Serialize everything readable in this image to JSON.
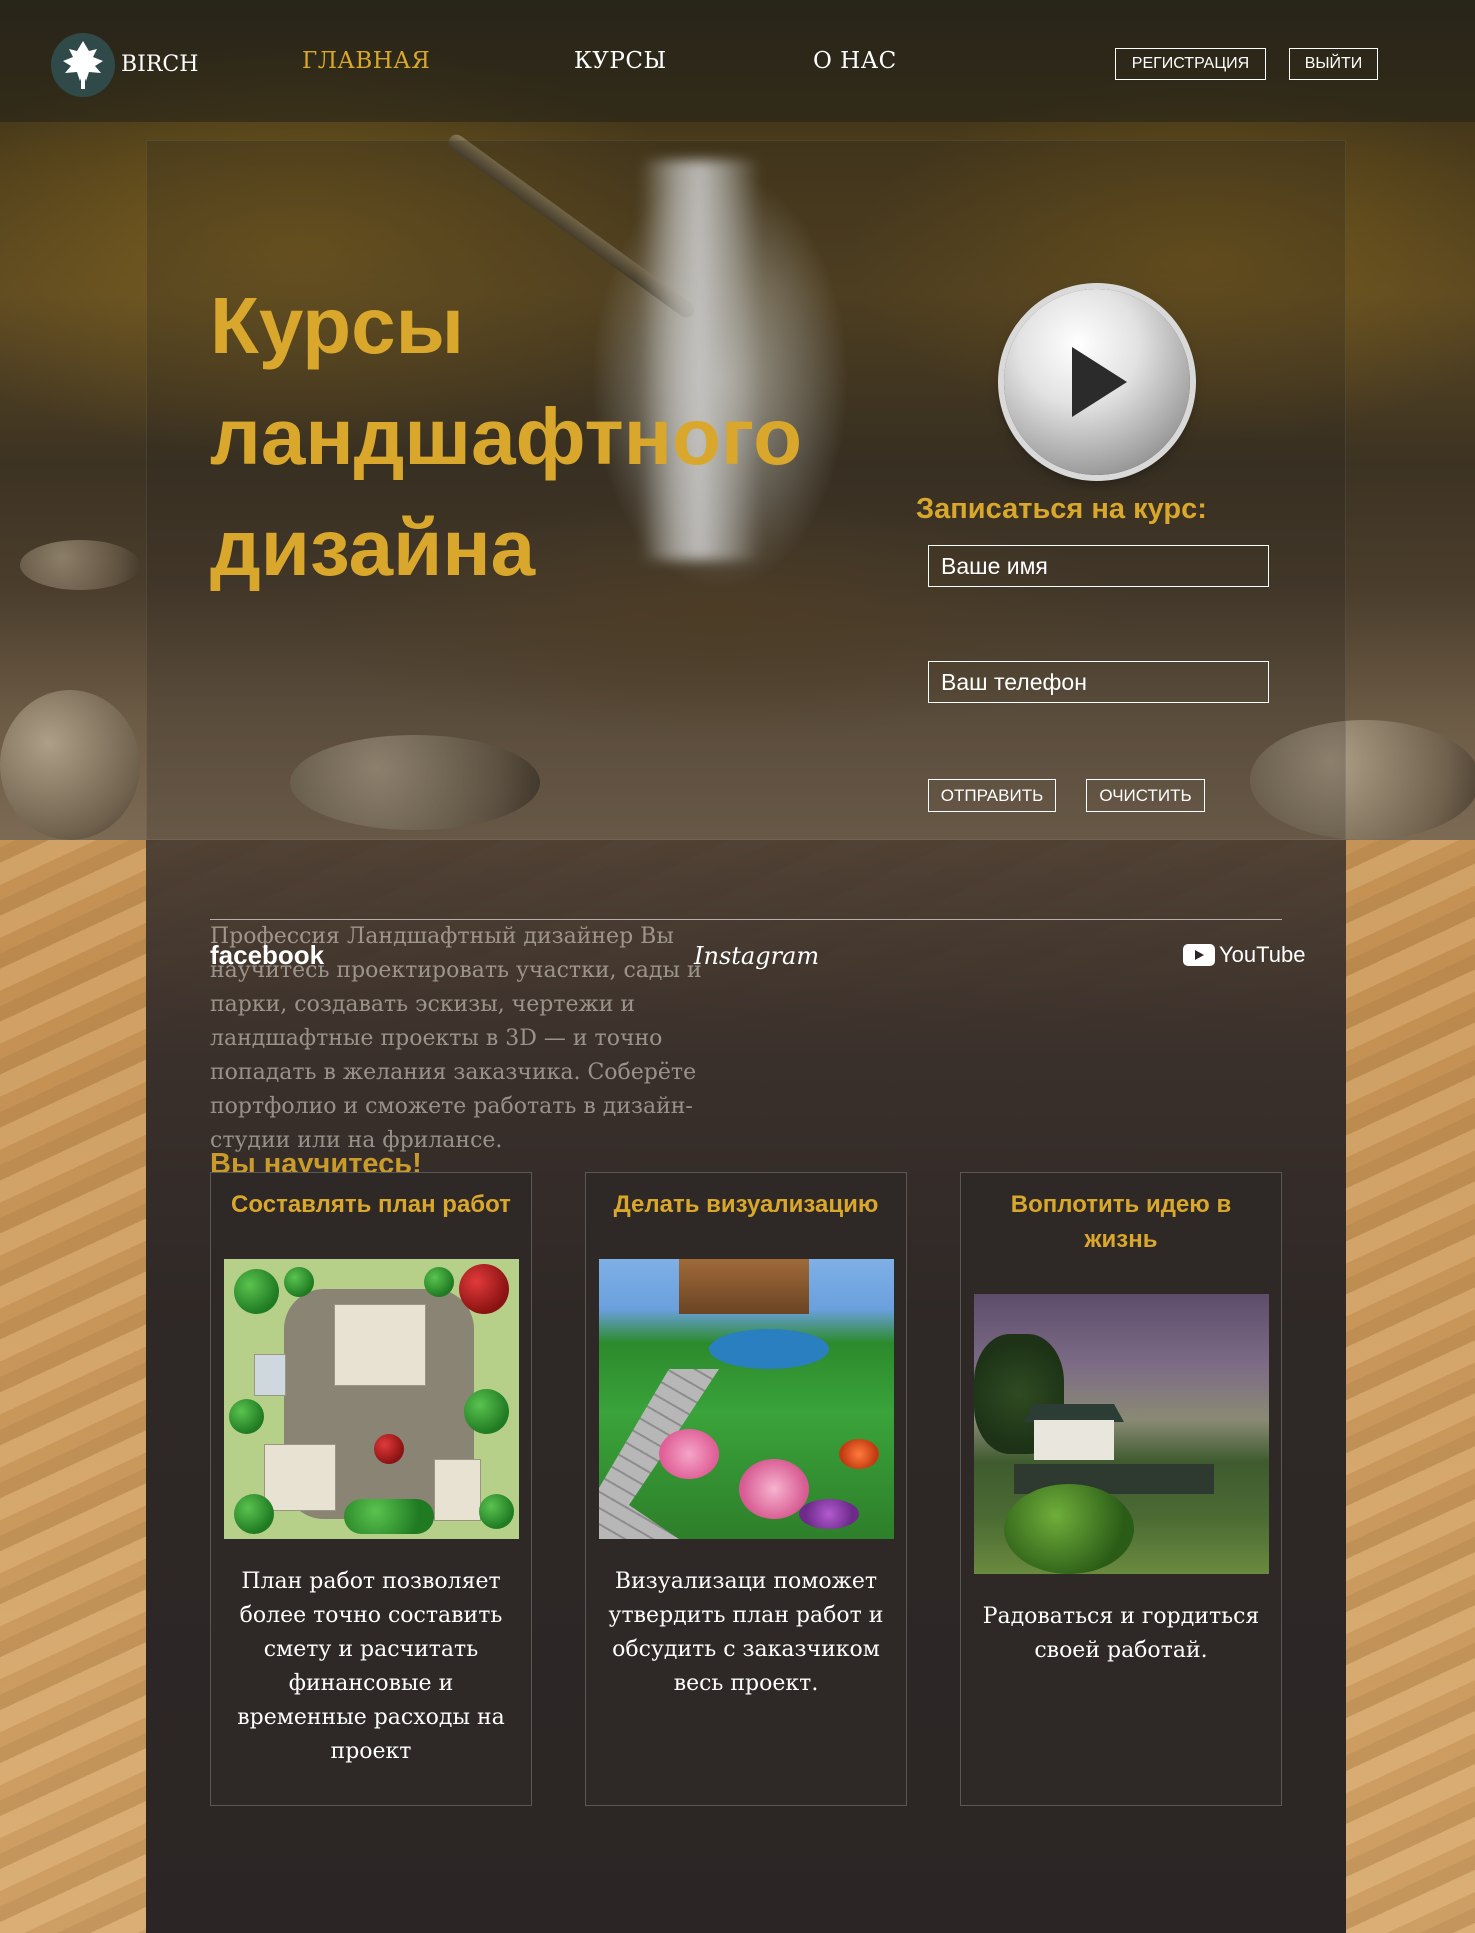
{
  "brand": {
    "name": "BIRCH"
  },
  "nav": {
    "links": [
      "ГЛАВНАЯ",
      "КУРСЫ",
      "О НАС"
    ],
    "active": "ГЛАВНАЯ",
    "register_label": "РЕГИСТРАЦИЯ",
    "logout_label": "ВЫЙТИ"
  },
  "hero": {
    "title_lines": [
      "Курсы",
      "ландшафтного",
      "дизайна"
    ]
  },
  "signup_form": {
    "title": "Записаться на курс:",
    "name_placeholder": "Ваше имя",
    "phone_placeholder": "Ваш телефон",
    "submit_label": "ОТПРАВИТЬ",
    "clear_label": "ОЧИСТИТЬ"
  },
  "social": {
    "facebook": "facebook",
    "instagram": "Instagram",
    "youtube": "YouTube"
  },
  "about": {
    "text": "Профессия Ландшафтный дизайнер Вы научитесь проектировать участки, сады и парки, создавать эскизы, чертежи и ландшафтные проекты в 3D — и точно попадать в желания заказчика. Соберёте портфолио и сможете работать в дизайн-студии или на фрилансе."
  },
  "learn": {
    "title": "Вы научитесь!",
    "cards": [
      {
        "title": "Составлять план работ",
        "text": "План работ позволяет более точно составить смету и расчитать финансовые и временные расходы на проект"
      },
      {
        "title": "Делать визуализацию",
        "text": "Визуализаци поможет утвердить план работ и обсудить с заказчиком весь проект."
      },
      {
        "title": "Воплотить идею в жизнь",
        "text": "Радоваться и гордиться своей работай."
      }
    ]
  },
  "colors": {
    "accent": "#d9a72b",
    "panel": "#2e2826",
    "sand": "#d5a66b"
  },
  "icons": {
    "logo": "tree-icon",
    "play": "play-icon",
    "youtube": "youtube-icon"
  }
}
